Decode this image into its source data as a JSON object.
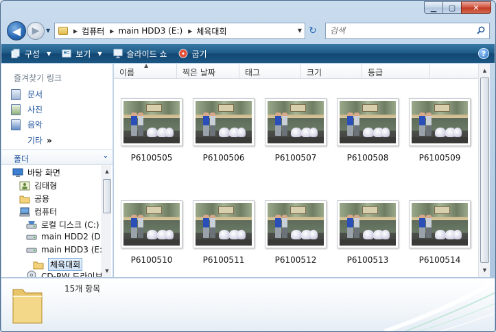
{
  "window": {
    "caption_buttons": {
      "minimize": "▁",
      "maximize": "▢",
      "close": "✕"
    }
  },
  "navigation": {
    "back_glyph": "◀",
    "forward_glyph": "▶",
    "history_glyph": "▼",
    "breadcrumbs": [
      "컴퓨터",
      "main HDD3 (E:)",
      "체육대회"
    ],
    "breadcrumb_sep": "▶",
    "dropdown_glyph": "▼",
    "refresh_glyph": "↻",
    "search_placeholder": "검색"
  },
  "toolbar": {
    "organize": "구성",
    "views": "보기",
    "slideshow": "슬라이드 쇼",
    "burn": "굽기",
    "help": "?",
    "arrow": "▼"
  },
  "sidebar": {
    "favorites_title": "즐겨찾기 링크",
    "favorites": [
      {
        "label": "문서",
        "icon": "document-icon"
      },
      {
        "label": "사진",
        "icon": "pictures-icon"
      },
      {
        "label": "음악",
        "icon": "music-icon"
      }
    ],
    "more_label": "기타",
    "more_glyph": "»",
    "folders_title": "폴더",
    "folders_chev": "⌄",
    "tree": [
      {
        "label": "바탕 화면",
        "icon": "desktop-icon"
      },
      {
        "label": "김태형",
        "icon": "user-folder-icon"
      },
      {
        "label": "공용",
        "icon": "folder-icon"
      },
      {
        "label": "컴퓨터",
        "icon": "computer-icon"
      },
      {
        "label": "로컬 디스크 (C:)",
        "icon": "drive-icon"
      },
      {
        "label": "main HDD2 (D:)",
        "icon": "drive-icon"
      },
      {
        "label": "main HDD3 (E:)",
        "icon": "drive-icon"
      },
      {
        "label": "체육대회",
        "icon": "folder-icon"
      },
      {
        "label": "CD-RW 드라이브",
        "icon": "cd-drive-icon"
      }
    ]
  },
  "columns": [
    "이름",
    "찍은 날짜",
    "태그",
    "크기",
    "등급"
  ],
  "files": [
    "P6100505",
    "P6100506",
    "P6100507",
    "P6100508",
    "P6100509",
    "P6100510",
    "P6100511",
    "P6100512",
    "P6100513",
    "P6100514"
  ],
  "details": {
    "count": "15개 항목"
  },
  "colors": {
    "accent": "#1e5a87",
    "link": "#1b4f9b"
  }
}
